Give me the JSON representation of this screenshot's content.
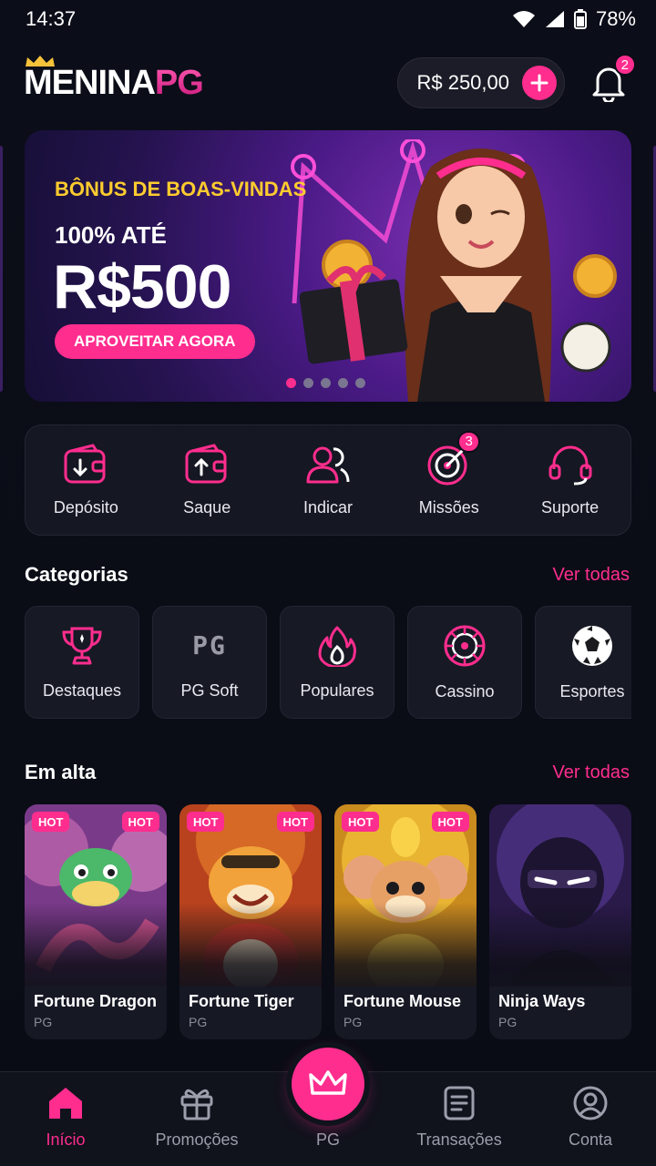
{
  "status_bar": {
    "time": "14:37",
    "battery": "78%"
  },
  "header": {
    "logo_main": "MENINA",
    "logo_accent": "PG",
    "balance": "R$ 250,00",
    "notifications_count": "2"
  },
  "banner": {
    "subtitle": "BÔNUS DE BOAS-VINDAS",
    "line": "100% ATÉ",
    "amount": "R$500",
    "cta": "APROVEITAR AGORA",
    "slide_count": 5,
    "active_slide": 1
  },
  "quick_actions": [
    {
      "label": "Depósito",
      "icon": "wallet-deposit-icon"
    },
    {
      "label": "Saque",
      "icon": "wallet-withdraw-icon"
    },
    {
      "label": "Indicar",
      "icon": "users-icon"
    },
    {
      "label": "Missões",
      "icon": "target-icon",
      "badge": "3"
    },
    {
      "label": "Suporte",
      "icon": "headset-icon"
    }
  ],
  "categories": {
    "title": "Categorias",
    "link": "Ver todas",
    "items": [
      {
        "label": "Destaques",
        "icon": "trophy-icon"
      },
      {
        "label": "PG Soft",
        "icon": "pg-logo-icon",
        "glyph": "PG"
      },
      {
        "label": "Populares",
        "icon": "flame-icon"
      },
      {
        "label": "Cassino",
        "icon": "roulette-icon"
      },
      {
        "label": "Esportes",
        "icon": "soccer-ball-icon"
      }
    ]
  },
  "trending": {
    "title": "Em alta",
    "link": "Ver todas",
    "hot_label": "HOT",
    "games": [
      {
        "name": "Fortune Dragon",
        "provider": "PG"
      },
      {
        "name": "Fortune Tiger",
        "provider": "PG"
      },
      {
        "name": "Fortune Mouse",
        "provider": "PG"
      },
      {
        "name": "Ninja Ways",
        "provider": "PG"
      }
    ]
  },
  "bottom_nav": [
    {
      "label": "Início",
      "icon": "home-icon",
      "active": true
    },
    {
      "label": "Promoções",
      "icon": "gift-icon"
    },
    {
      "label": "PG",
      "icon": "crown-icon"
    },
    {
      "label": "Transações",
      "icon": "document-icon"
    },
    {
      "label": "Conta",
      "icon": "user-circle-icon"
    }
  ],
  "colors": {
    "accent": "#ff2d8e",
    "gold": "#ffcc2e",
    "background": "#0b0d18",
    "card": "#151722"
  }
}
